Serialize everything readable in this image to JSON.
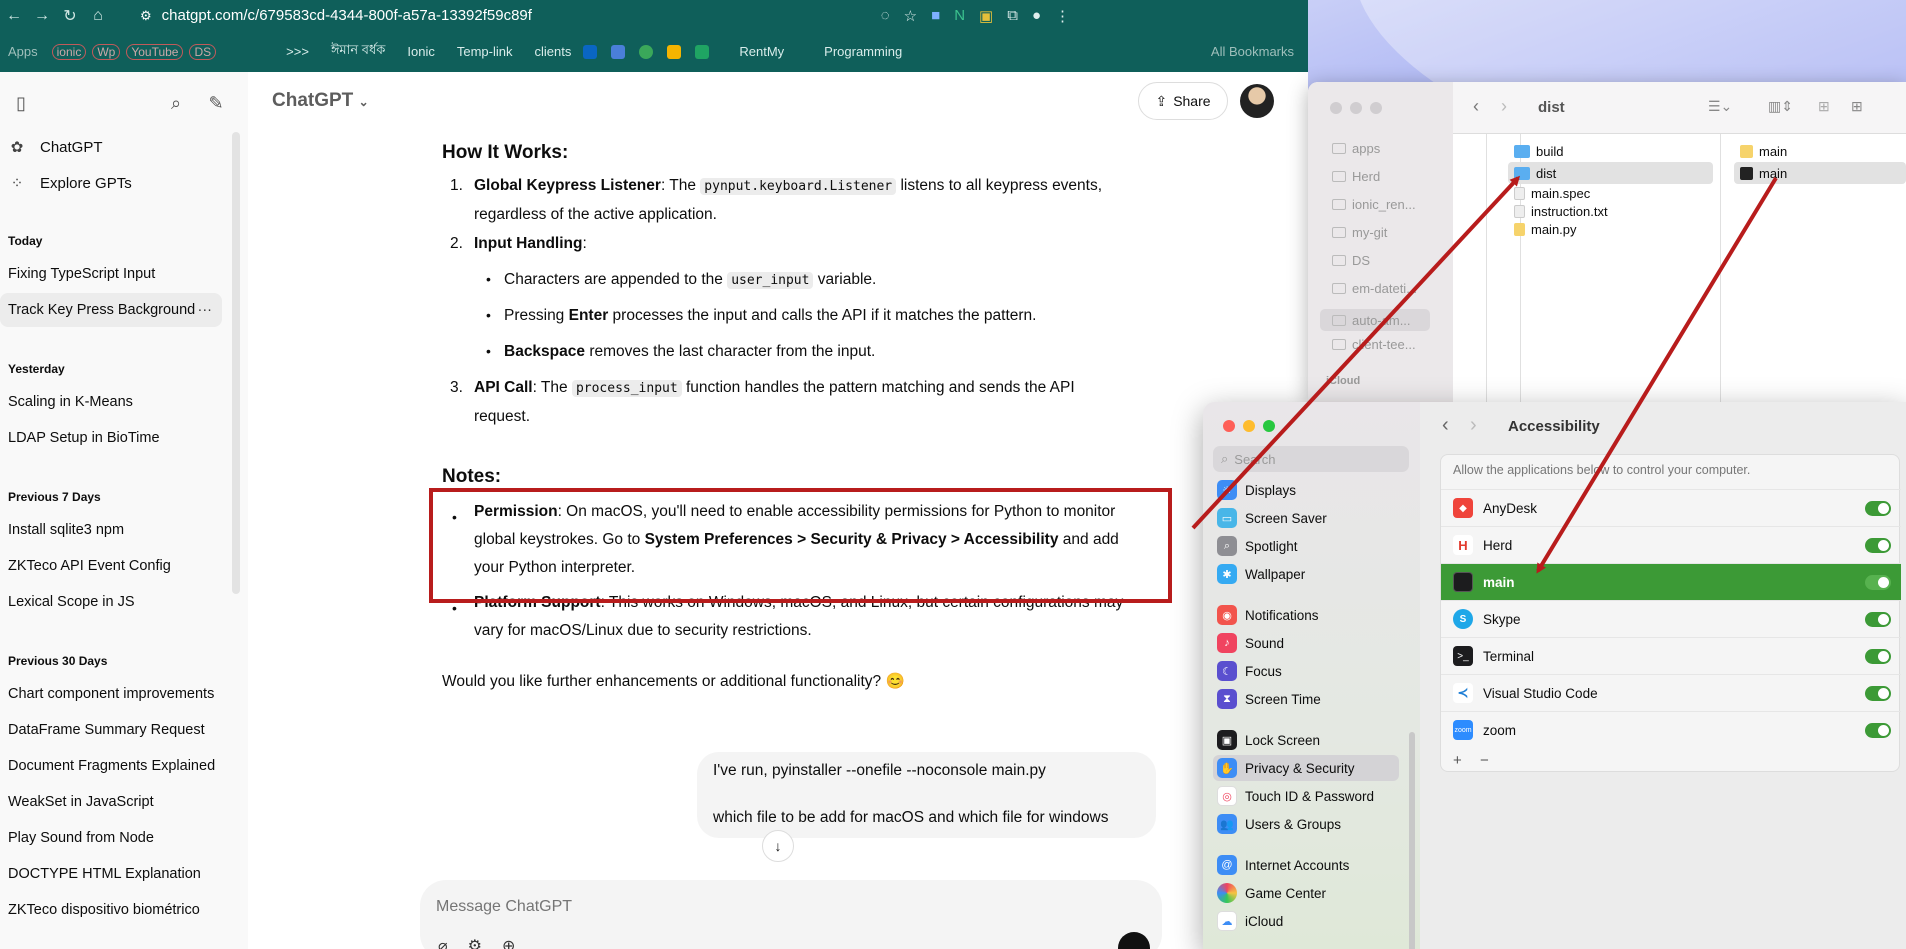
{
  "browser": {
    "url": "chatgpt.com/c/679583cd-4344-800f-a57a-13392f59c89f",
    "bookmarks": [
      "Apps",
      "ionic",
      "Wp",
      "YouTube",
      "DS",
      ">>>",
      "ঈমান বর্ধক",
      "Ionic",
      "Temp-link",
      "clients",
      "RentMy",
      "Programming"
    ],
    "all_bookmarks": "All Bookmarks"
  },
  "sidebar": {
    "chatgpt": "ChatGPT",
    "explore": "Explore GPTs",
    "sections": [
      {
        "title": "Today",
        "items": [
          "Fixing TypeScript Input",
          "Track Key Press Background"
        ]
      },
      {
        "title": "Yesterday",
        "items": [
          "Scaling in K-Means",
          "LDAP Setup in BioTime"
        ]
      },
      {
        "title": "Previous 7 Days",
        "items": [
          "Install sqlite3 npm",
          "ZKTeco API Event Config",
          "Lexical Scope in JS"
        ]
      },
      {
        "title": "Previous 30 Days",
        "items": [
          "Chart component improvements",
          "DataFrame Summary Request",
          "Document Fragments Explained",
          "WeakSet in JavaScript",
          "Play Sound from Node",
          "DOCTYPE HTML Explanation",
          "ZKTeco dispositivo biométrico"
        ]
      }
    ],
    "active_item": "Track Key Press Background"
  },
  "chat": {
    "model": "ChatGPT",
    "share": "Share",
    "how_title": "How It Works:",
    "item1_num": "1.",
    "item1_bold": "Global Keypress Listener",
    "item1_a": ": The ",
    "item1_code": "pynput.keyboard.Listener",
    "item1_b": " listens to all keypress events,",
    "item1_c": "regardless of the active application.",
    "item2_num": "2.",
    "item2_bold": "Input Handling",
    "item2_colon": ":",
    "b1_a": "Characters are appended to the ",
    "b1_code": "user_input",
    "b1_b": " variable.",
    "b2_a": "Pressing ",
    "b2_bold": "Enter",
    "b2_b": " processes the input and calls the API if it matches the pattern.",
    "b3_bold": "Backspace",
    "b3_b": " removes the last character from the input.",
    "item3_num": "3.",
    "item3_bold": "API Call",
    "item3_a": ": The ",
    "item3_code": "process_input",
    "item3_b": " function handles the pattern matching and sends the API",
    "item3_c": "request.",
    "notes_title": "Notes:",
    "perm_bold": "Permission",
    "perm_a": ": On macOS, you'll need to enable accessibility permissions for Python to monitor",
    "perm_b": "global keystrokes. Go to ",
    "perm_bold2": "System Preferences > Security & Privacy > Accessibility",
    "perm_c": " and add",
    "perm_d": "your Python interpreter.",
    "plat_bold": "Platform Support",
    "plat_a": ": This works on Windows, macOS, and Linux, but certain configurations may",
    "plat_b": "vary for macOS/Linux due to security restrictions.",
    "closing": "Would you like further enhancements or additional functionality? 😊",
    "user_line1": "I've run, pyinstaller --onefile --noconsole main.py",
    "user_line2": "which file to be add for macOS and which file for windows",
    "composer_placeholder": "Message ChatGPT"
  },
  "finder": {
    "title": "dist",
    "sidebar_items": [
      "apps",
      "Herd",
      "ionic_ren...",
      "my-git",
      "DS",
      "em-dateti...",
      "auto-am...",
      "client-tee..."
    ],
    "icloud": "iCloud",
    "col1": [
      "build",
      "dist",
      "main.spec",
      "instruction.txt",
      "main.py"
    ],
    "col2": [
      "main",
      "main"
    ]
  },
  "settings": {
    "search_placeholder": "Search",
    "title": "Accessibility",
    "description": "Allow the applications below to control your computer.",
    "sidebar_groups": [
      [
        "Displays",
        "Screen Saver",
        "Spotlight",
        "Wallpaper"
      ],
      [
        "Notifications",
        "Sound",
        "Focus",
        "Screen Time"
      ],
      [
        "Lock Screen",
        "Privacy & Security",
        "Touch ID & Password",
        "Users & Groups"
      ],
      [
        "Internet Accounts",
        "Game Center",
        "iCloud"
      ]
    ],
    "active_item": "Privacy & Security",
    "apps": [
      "AnyDesk",
      "Herd",
      "main",
      "Skype",
      "Terminal",
      "Visual Studio Code",
      "zoom"
    ],
    "selected_app": "main",
    "plus": "+",
    "minus": "−"
  },
  "colors": {
    "chrome_bar": "#0f5f5a",
    "annotation_red": "#b81c1c",
    "selection_green": "#3c9a36"
  }
}
